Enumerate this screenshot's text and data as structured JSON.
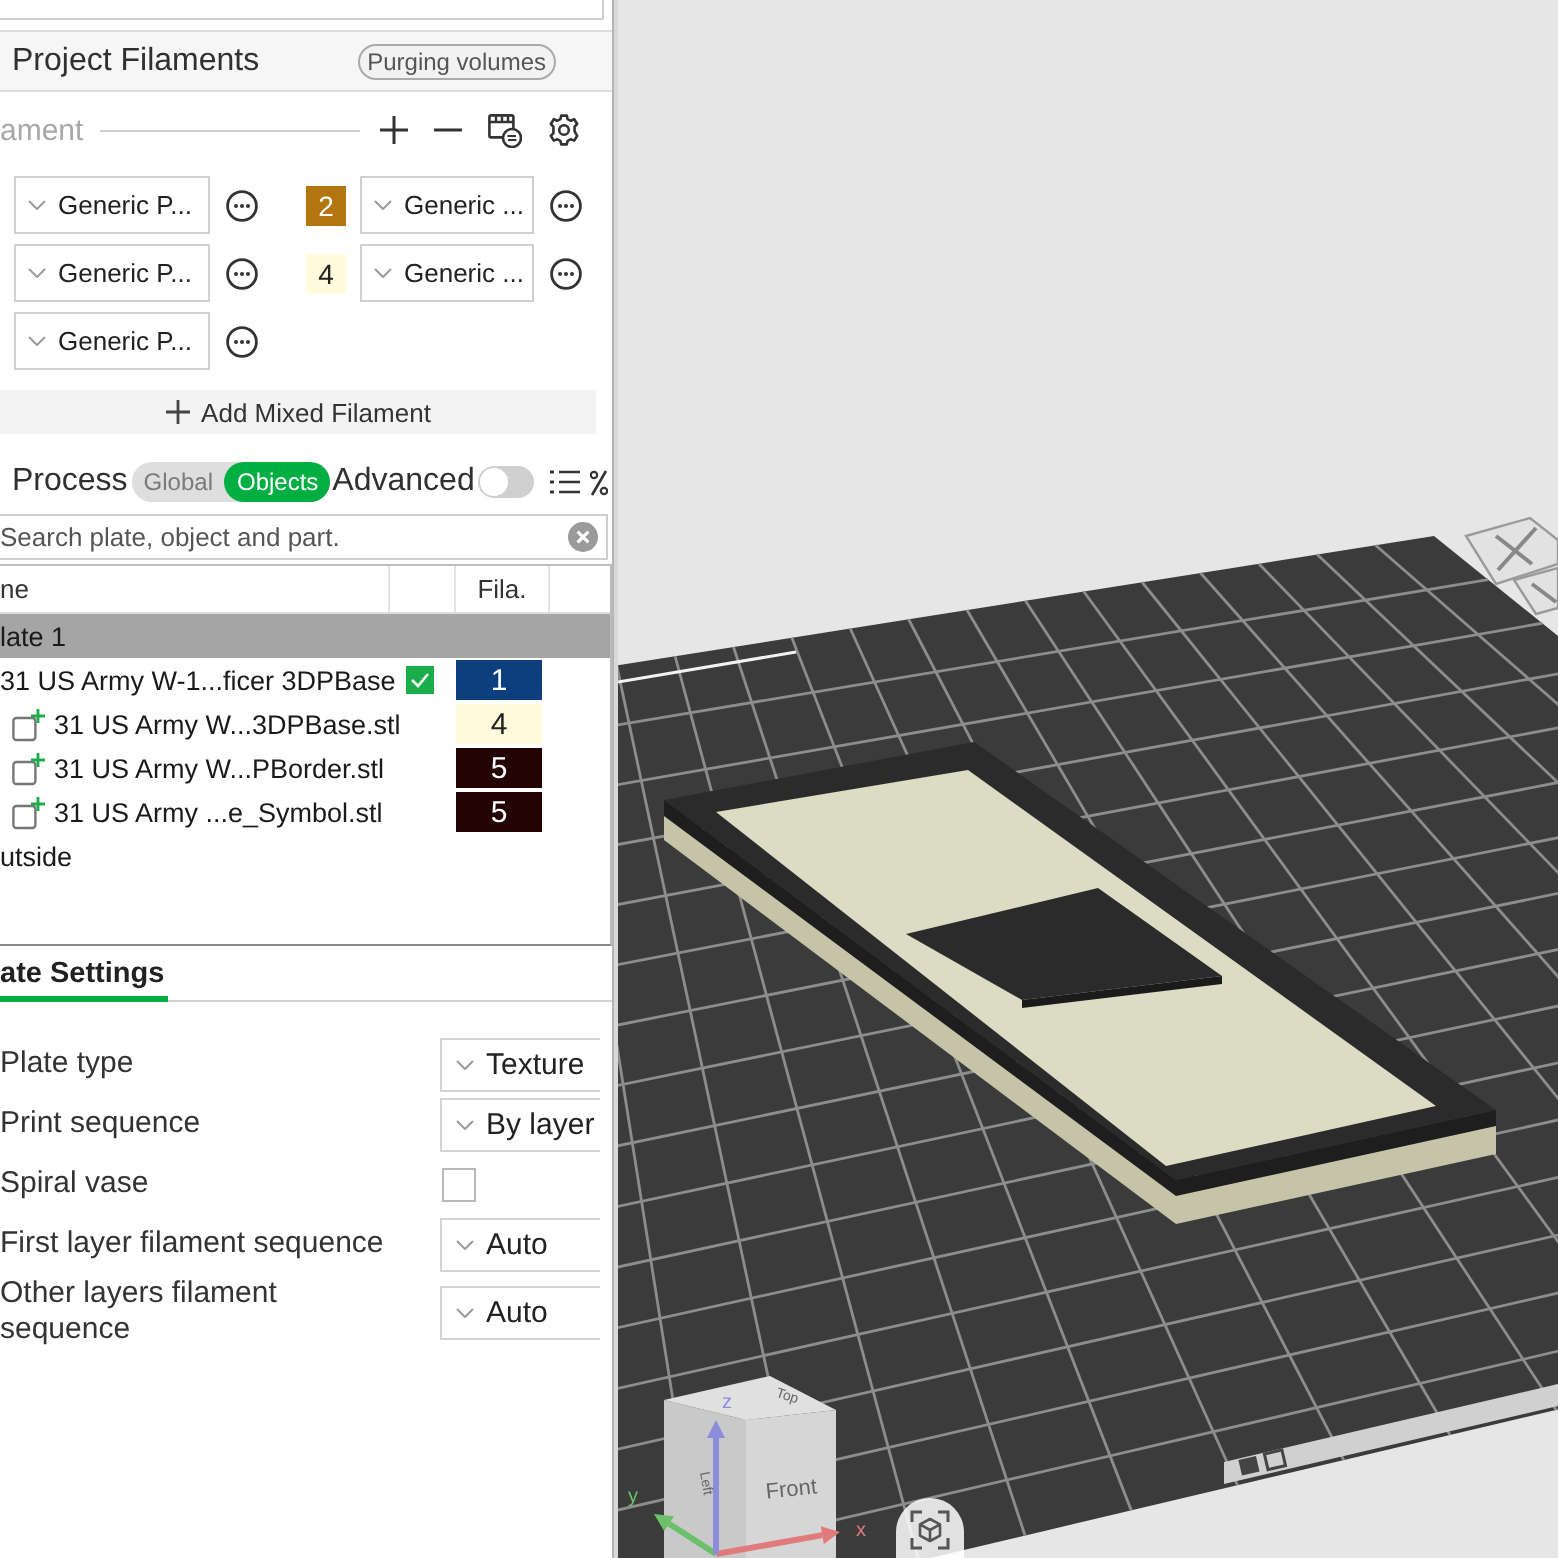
{
  "project_filaments": {
    "title": "Project Filaments",
    "purging_button": "Purging volumes",
    "filament_label": "ament",
    "filaments": [
      {
        "name": "Generic P..."
      },
      {
        "number": "2",
        "color": "#b3760f",
        "name": "Generic ..."
      },
      {
        "name": "Generic P..."
      },
      {
        "number": "4",
        "color": "#fffbdc",
        "name": "Generic ..."
      },
      {
        "name": "Generic P..."
      }
    ],
    "add_mixed_button": "Add Mixed Filament"
  },
  "process": {
    "title": "Process",
    "scope_tabs": [
      {
        "label": "Global",
        "selected": false
      },
      {
        "label": "Objects",
        "selected": true
      }
    ],
    "advanced_label": "Advanced",
    "advanced_on": false
  },
  "object_list": {
    "search": {
      "placeholder": "Search plate, object and part."
    },
    "columns": [
      "ne",
      "Fila."
    ],
    "rows": [
      {
        "kind": "plate",
        "name": "late 1",
        "selected": true
      },
      {
        "kind": "object",
        "name": "31 US Army W-1...ficer 3DPBase",
        "selected": false,
        "checked": true,
        "filament": "1",
        "color": "#0d3f7f",
        "children": [
          {
            "kind": "part",
            "name": "31 US Army W...3DPBase.stl",
            "selected": false,
            "filament": "4",
            "color": "#fffbdc"
          },
          {
            "kind": "part",
            "name": "31 US Army W...PBorder.stl",
            "selected": false,
            "filament": "5",
            "color": "#240303"
          },
          {
            "kind": "part",
            "name": "31 US Army ...e_Symbol.stl",
            "selected": false,
            "filament": "5",
            "color": "#240303"
          }
        ]
      },
      {
        "kind": "group",
        "name": "utside",
        "selected": false
      }
    ]
  },
  "plate_settings": {
    "tabs": [
      {
        "label": "ate Settings",
        "selected": true
      }
    ],
    "rows": [
      {
        "label": "Plate type",
        "kind": "select",
        "value": "Texture"
      },
      {
        "label": "Print sequence",
        "kind": "select",
        "value": "By layer"
      },
      {
        "label": "Spiral vase",
        "kind": "checkbox",
        "checked": false
      },
      {
        "label": "First layer filament sequence",
        "kind": "select",
        "value": "Auto"
      },
      {
        "label": "Other layers filament sequence",
        "kind": "select",
        "value": "Auto"
      }
    ]
  },
  "viewport": {
    "view_cube": {
      "faces": [
        {
          "kind": "top",
          "label": "Top"
        },
        {
          "kind": "front",
          "label": "Front"
        },
        {
          "kind": "left",
          "label": "Left"
        }
      ]
    },
    "axes": [
      {
        "label": "x",
        "color": "#e07b7b"
      },
      {
        "label": "y",
        "color": "#6cc06c"
      },
      {
        "label": "z",
        "color": "#8c8cdc"
      }
    ]
  }
}
